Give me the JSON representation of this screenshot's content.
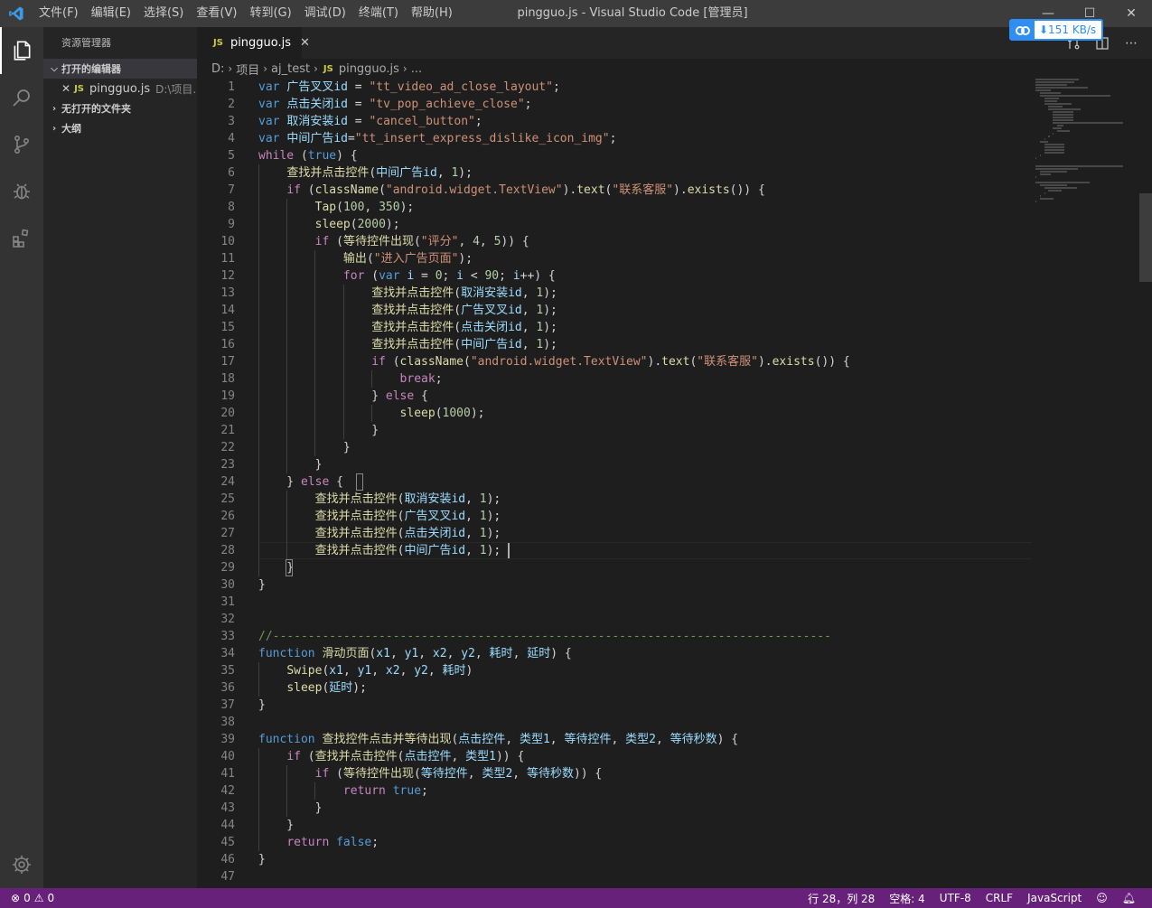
{
  "window": {
    "title": "pingguo.js - Visual Studio Code [管理员]",
    "menu": [
      "文件(F)",
      "编辑(E)",
      "选择(S)",
      "查看(V)",
      "转到(G)",
      "调试(D)",
      "终端(T)",
      "帮助(H)"
    ],
    "controls": {
      "minimize": "—",
      "maximize": "☐",
      "close": "✕"
    }
  },
  "speed_badge": {
    "text": "⬇151 KB/s",
    "color": "#2f8ef3"
  },
  "activity_bar": {
    "items": [
      "explorer-icon",
      "search-icon",
      "source-control-icon",
      "debug-icon",
      "extensions-icon"
    ],
    "bottom": "settings-gear-icon"
  },
  "sidebar": {
    "title": "资源管理器",
    "open_editors": {
      "label": "打开的编辑器",
      "files": [
        {
          "badge": "JS",
          "name": "pingguo.js",
          "path": "D:\\项目..."
        }
      ]
    },
    "no_folder": "无打开的文件夹",
    "outline": "大纲"
  },
  "tab": {
    "badge": "JS",
    "name": "pingguo.js",
    "close": "✕"
  },
  "breadcrumb": [
    "D:",
    "项目",
    "aj_test",
    "pingguo.js",
    "..."
  ],
  "breadcrumb_badge": "JS",
  "editor": {
    "lines": [
      "var 广告叉叉id = \"tt_video_ad_close_layout\";",
      "var 点击关闭id = \"tv_pop_achieve_close\";",
      "var 取消安装id = \"cancel_button\";",
      "var 中间广告id=\"tt_insert_express_dislike_icon_img\";",
      "while (true) {",
      "    查找并点击控件(中间广告id, 1);",
      "    if (className(\"android.widget.TextView\").text(\"联系客服\").exists()) {",
      "        Tap(100, 350);",
      "        sleep(2000);",
      "        if (等待控件出现(\"评分\", 4, 5)) {",
      "            输出(\"进入广告页面\");",
      "            for (var i = 0; i < 90; i++) {",
      "                查找并点击控件(取消安装id, 1);",
      "                查找并点击控件(广告叉叉id, 1);",
      "                查找并点击控件(点击关闭id, 1);",
      "                查找并点击控件(中间广告id, 1);",
      "                if (className(\"android.widget.TextView\").text(\"联系客服\").exists()) {",
      "                    break;",
      "                } else {",
      "                    sleep(1000);",
      "                }",
      "            }",
      "        }",
      "    } else {",
      "        查找并点击控件(取消安装id, 1);",
      "        查找并点击控件(广告叉叉id, 1);",
      "        查找并点击控件(点击关闭id, 1);",
      "        查找并点击控件(中间广告id, 1);",
      "    }",
      "}",
      "",
      "",
      "//-------------------------------------------------------------------------------",
      "function 滑动页面(x1, y1, x2, y2, 耗时, 延时) {",
      "    Swipe(x1, y1, x2, y2, 耗时)",
      "    sleep(延时);",
      "}",
      "",
      "function 查找控件点击并等待出现(点击控件, 类型1, 等待控件, 类型2, 等待秒数) {",
      "    if (查找并点击控件(点击控件, 类型1)) {",
      "        if (等待控件出现(等待控件, 类型2, 等待秒数)) {",
      "            return true;",
      "        }",
      "    }",
      "    return false;",
      "}",
      ""
    ]
  },
  "status_bar": {
    "errors": "0",
    "warnings": "0",
    "position": "行 28，列 28",
    "spaces": "空格: 4",
    "encoding": "UTF-8",
    "eol": "CRLF",
    "language": "JavaScript",
    "bg_color": "#68217a"
  }
}
